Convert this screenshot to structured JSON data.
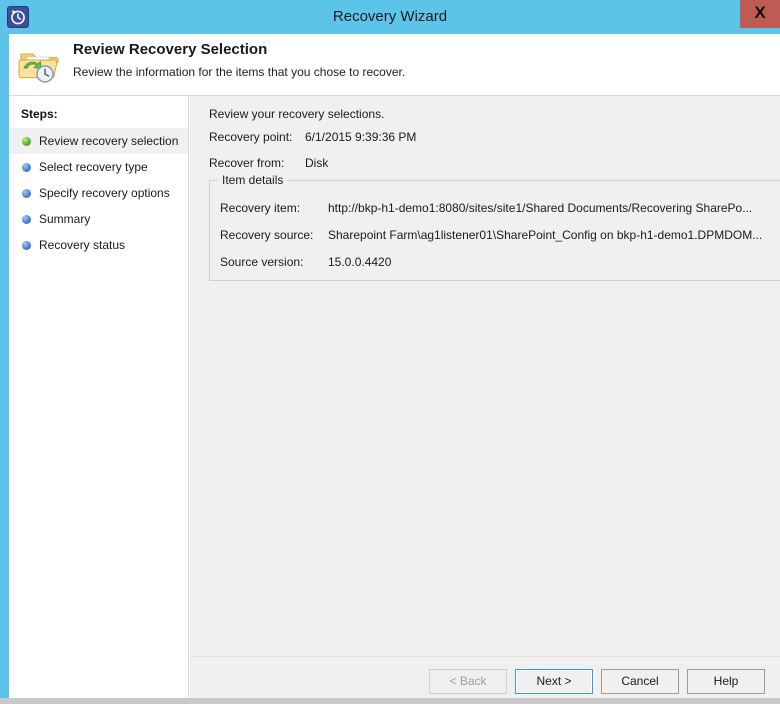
{
  "window": {
    "title": "Recovery Wizard",
    "titlebar_icon": "recovery-clock-icon",
    "close_label": "X",
    "accent_color": "#5bc4e8",
    "close_button_color": "#bf5b53"
  },
  "header": {
    "icon": "folder-recovery-icon",
    "title": "Review Recovery Selection",
    "subtitle": "Review the information for the items that you chose to recover."
  },
  "sidebar": {
    "heading": "Steps:",
    "items": [
      {
        "label": "Review recovery selection",
        "state": "current",
        "bullet_color": "#66c23a"
      },
      {
        "label": "Select recovery type",
        "state": "pending",
        "bullet_color": "#5a8fd8"
      },
      {
        "label": "Specify recovery options",
        "state": "pending",
        "bullet_color": "#5a8fd8"
      },
      {
        "label": "Summary",
        "state": "pending",
        "bullet_color": "#5a8fd8"
      },
      {
        "label": "Recovery status",
        "state": "pending",
        "bullet_color": "#5a8fd8"
      }
    ]
  },
  "main": {
    "intro": "Review your recovery selections.",
    "summary": [
      {
        "label": "Recovery point:",
        "value": "6/1/2015 9:39:36 PM"
      },
      {
        "label": "Recover from:",
        "value": "Disk"
      }
    ],
    "item_details": {
      "legend": "Item details",
      "rows": [
        {
          "label": "Recovery item:",
          "value": "http://bkp-h1-demo1:8080/sites/site1/Shared Documents/Recovering SharePo..."
        },
        {
          "label": "Recovery source:",
          "value": "Sharepoint Farm\\ag1listener01\\SharePoint_Config on bkp-h1-demo1.DPMDOM..."
        },
        {
          "label": "Source version:",
          "value": "15.0.0.4420"
        }
      ]
    }
  },
  "buttons": {
    "back": "< Back",
    "next": "Next >",
    "cancel": "Cancel",
    "help": "Help"
  }
}
